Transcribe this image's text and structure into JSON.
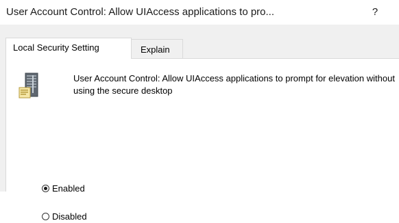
{
  "window": {
    "title": "User Account Control: Allow UIAccess applications to pro...",
    "help_label": "?"
  },
  "tabs": [
    {
      "label": "Local Security Setting",
      "selected": true
    },
    {
      "label": "Explain",
      "selected": false
    }
  ],
  "policy": {
    "icon": "server-policy-icon",
    "description": "User Account Control: Allow UIAccess applications to prompt for elevation without using the secure desktop"
  },
  "options": [
    {
      "label": "Enabled",
      "selected": true
    },
    {
      "label": "Disabled",
      "selected": false
    }
  ],
  "colors": {
    "background": "#f0f0f0",
    "panel": "#ffffff",
    "border": "#d9d9d9"
  }
}
